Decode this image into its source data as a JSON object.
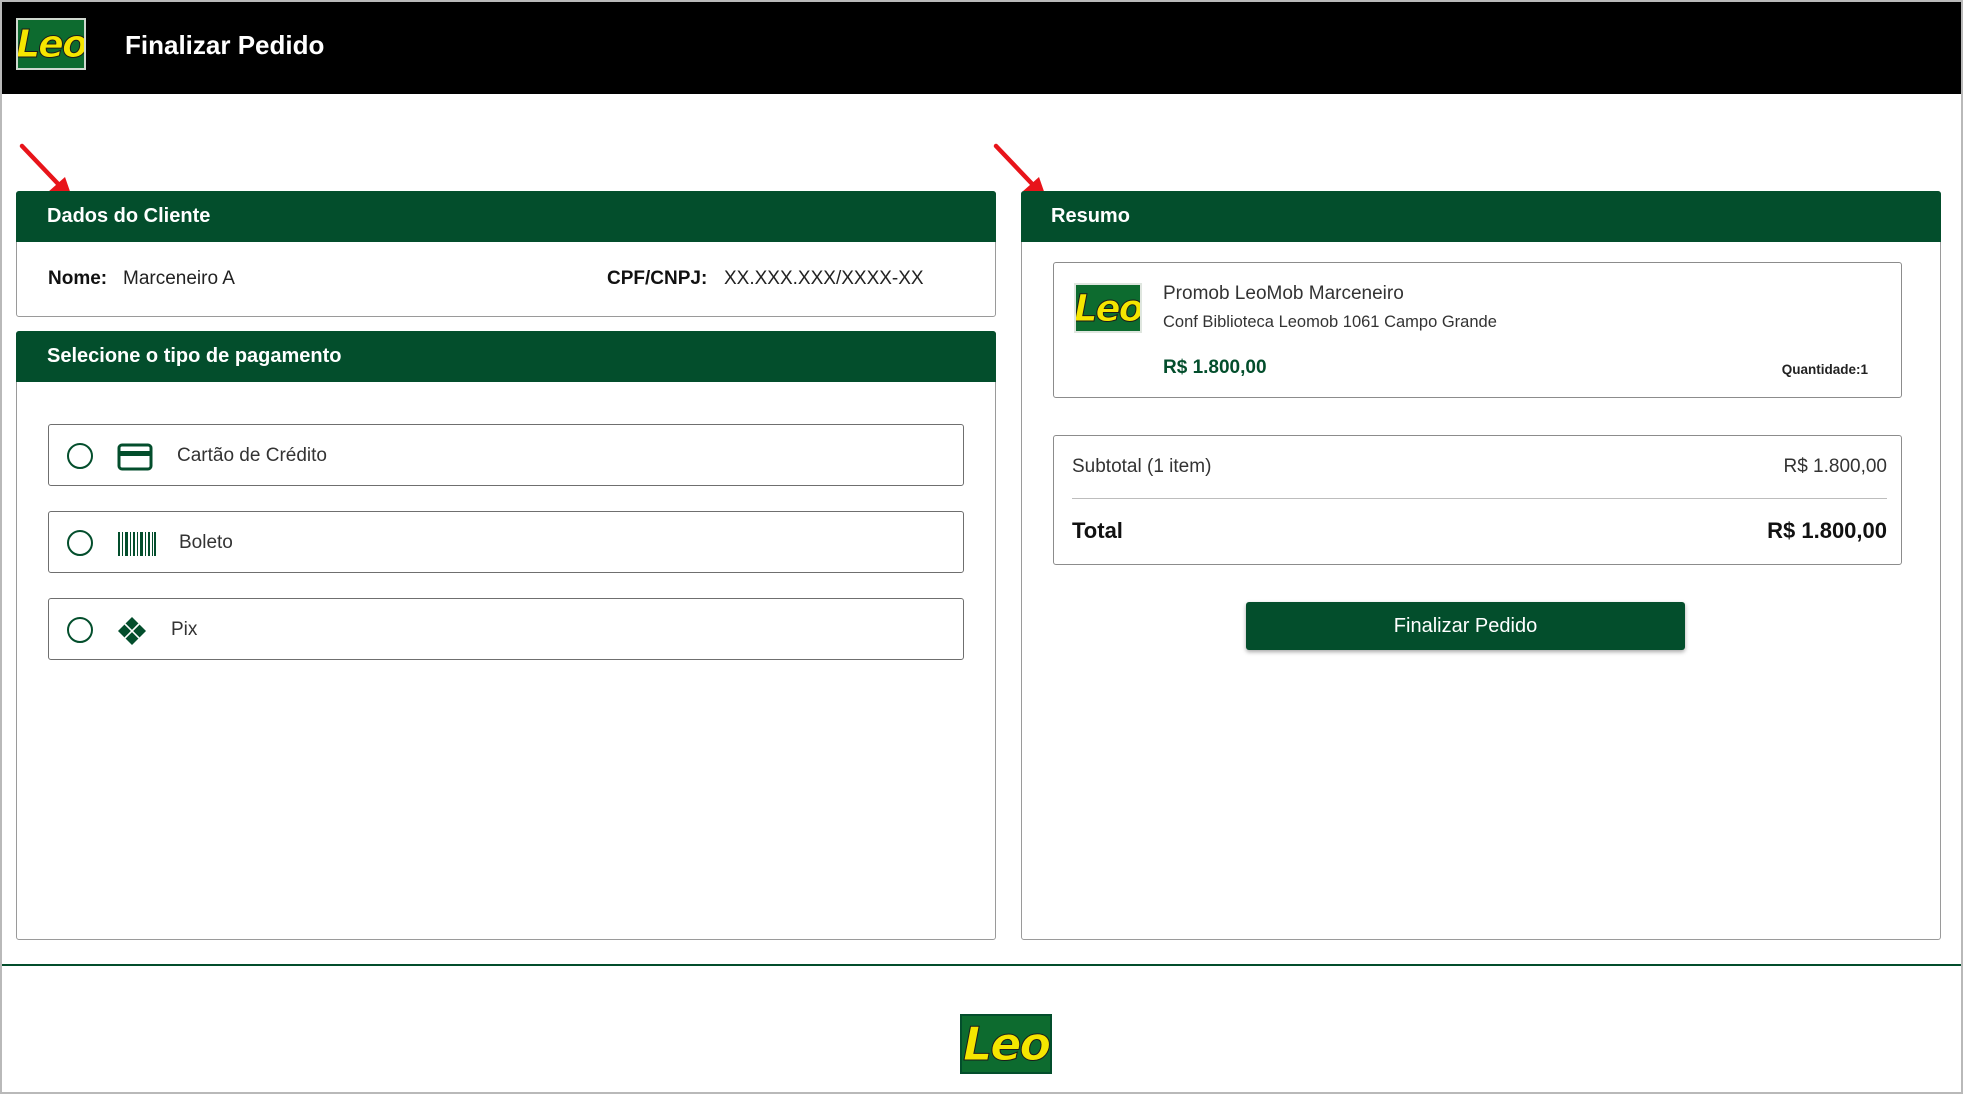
{
  "header": {
    "logo_text": "Leo",
    "title": "Finalizar Pedido"
  },
  "client": {
    "section_title": "Dados do Cliente",
    "name_label": "Nome:",
    "name_value": "Marceneiro A",
    "doc_label": "CPF/CNPJ:",
    "doc_value": "XX.XXX.XXX/XXXX-XX"
  },
  "payment": {
    "section_title": "Selecione o tipo de pagamento",
    "options": [
      {
        "label": "Cartão de Crédito",
        "icon": "credit-card-icon",
        "selected": false
      },
      {
        "label": "Boleto",
        "icon": "barcode-icon",
        "selected": false
      },
      {
        "label": "Pix",
        "icon": "pix-icon",
        "selected": false
      }
    ]
  },
  "summary": {
    "section_title": "Resumo",
    "product": {
      "logo_text": "Leo",
      "name": "Promob LeoMob Marceneiro",
      "description": "Conf Biblioteca Leomob 1061 Campo Grande",
      "price": "R$ 1.800,00",
      "quantity": "Quantidade:1"
    },
    "subtotal_label": "Subtotal (1 item)",
    "subtotal_value": "R$ 1.800,00",
    "total_label": "Total",
    "total_value": "R$ 1.800,00",
    "finalize_button": "Finalizar Pedido"
  },
  "footer": {
    "logo_text": "Leo"
  },
  "colors": {
    "brand_green": "#034e2c",
    "logo_green": "#0d6b2f",
    "logo_yellow": "#f5e600",
    "header_bg": "#000000",
    "annotation_red": "#e8141a"
  }
}
